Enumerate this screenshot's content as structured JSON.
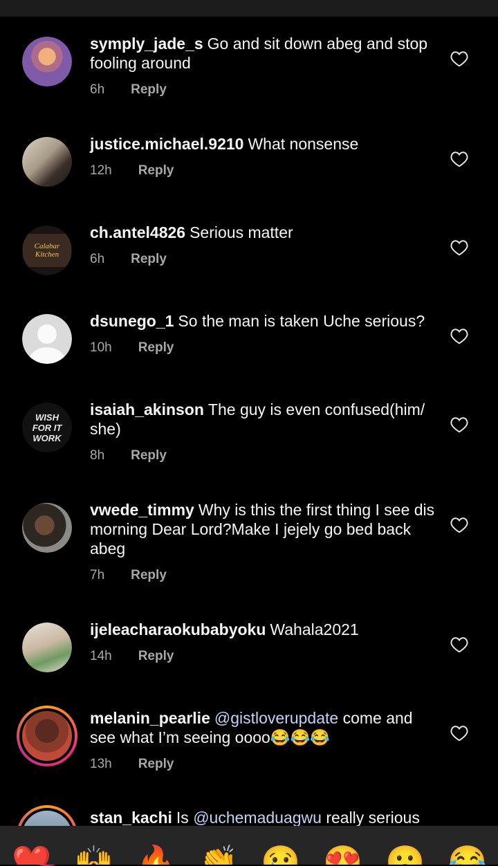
{
  "comments": [
    {
      "username": "symply_jade_s",
      "text": "Go and sit down abeg and stop fooling around",
      "time": "6h",
      "reply": "Reply"
    },
    {
      "username": "justice.michael.9210",
      "text": "What nonsense",
      "time": "12h",
      "reply": "Reply"
    },
    {
      "username": "ch.antel4826",
      "text": "Serious matter",
      "time": "6h",
      "reply": "Reply",
      "avatar_text": "Calabar Kitchen"
    },
    {
      "username": "dsunego_1",
      "text": "So the man is taken Uche serious?",
      "time": "10h",
      "reply": "Reply"
    },
    {
      "username": "isaiah_akinson",
      "text": "The guy is even confused(him/ she)",
      "time": "8h",
      "reply": "Reply",
      "avatar_text": "WISH FOR IT WORK"
    },
    {
      "username": "vwede_timmy",
      "text": "Why is this the first thing I see dis morning Dear Lord?Make I jejely go bed back abeg",
      "time": "7h",
      "reply": "Reply"
    },
    {
      "username": "ijeleacharaokubabyoku",
      "text": "Wahala2021",
      "time": "14h",
      "reply": "Reply"
    },
    {
      "username": "melanin_pearlie",
      "mention": "@gistloverupdate",
      "text": "come and see what I’m seeing oooo😂😂😂",
      "time": "13h",
      "reply": "Reply"
    },
    {
      "username": "stan_kachi",
      "text_pre": "Is",
      "mention": "@uchemaduagwu",
      "text": "really serious"
    }
  ],
  "reactions": [
    "❤️",
    "🙌",
    "🔥",
    "👏",
    "😢",
    "😍",
    "😮",
    "😂"
  ],
  "icons": {
    "like": "heart-outline-icon"
  }
}
